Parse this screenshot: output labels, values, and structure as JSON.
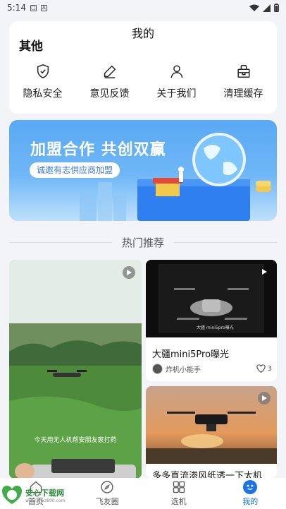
{
  "status_bar": {
    "time": "5:14"
  },
  "page": {
    "title": "我的"
  },
  "other": {
    "section_title": "其他",
    "items": [
      {
        "label": "隐私安全",
        "icon": "shield-check-icon"
      },
      {
        "label": "意见反馈",
        "icon": "edit-pen-icon"
      },
      {
        "label": "关于我们",
        "icon": "person-icon"
      },
      {
        "label": "清理缓存",
        "icon": "cache-box-icon"
      }
    ]
  },
  "banner": {
    "title": "加盟合作 共创双赢",
    "cta": "诚邀有志供应商加盟",
    "colors": {
      "top": "#5aa9f3",
      "bottom": "#bfe0fb"
    }
  },
  "recommend": {
    "label": "热门推荐"
  },
  "feed": [
    {
      "caption": "今天用无人机帮安朋友家打药"
    },
    {
      "title": "大疆mini5Pro曝光",
      "author": "炸机小能手",
      "likes": "3",
      "thumb_text": "大疆 mini5pro曝光"
    },
    {
      "title": "多多直流渗风纸透一下太机"
    }
  ],
  "tabs": [
    {
      "label": "首页",
      "icon": "home-icon",
      "active": false
    },
    {
      "label": "飞友圈",
      "icon": "compass-icon",
      "active": false
    },
    {
      "label": "选机",
      "icon": "grid-icon",
      "active": false
    },
    {
      "label": "我的",
      "icon": "profile-icon",
      "active": true
    }
  ],
  "watermark": {
    "name": "安心下载网",
    "url": "www.anxz800.com",
    "badge": "安心 安卓"
  },
  "colors": {
    "accent": "#1a73e8",
    "background": "#f3f4f7"
  }
}
